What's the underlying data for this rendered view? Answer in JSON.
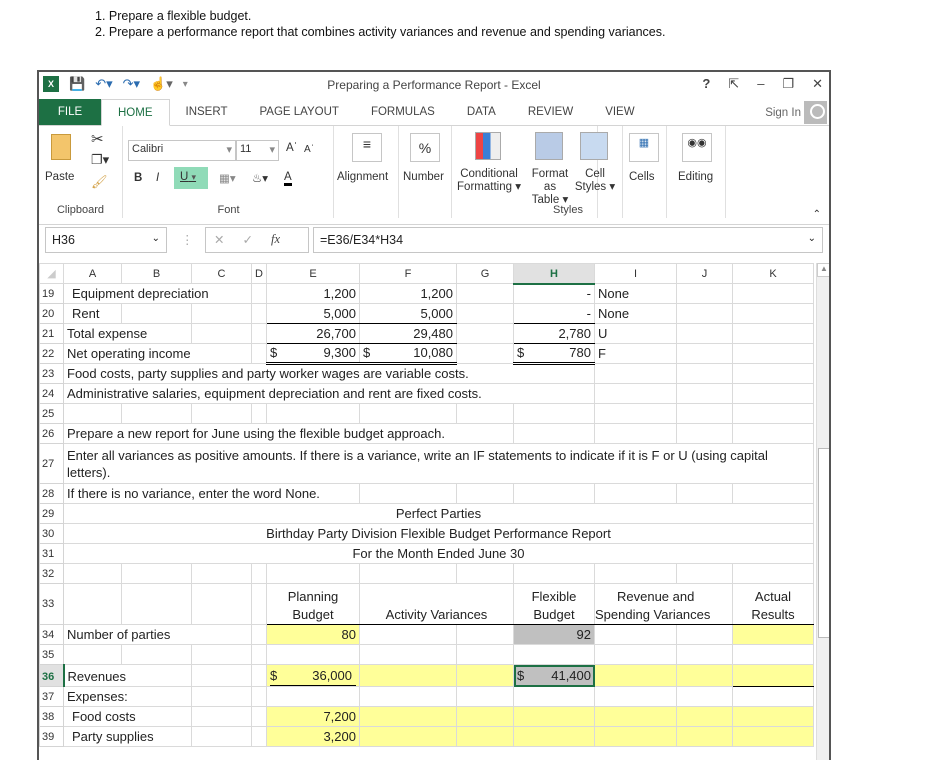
{
  "instructions": [
    "1. Prepare a flexible budget.",
    "2. Prepare a performance report that combines activity variances and revenue and spending variances."
  ],
  "window": {
    "title": "Preparing a Performance Report - Excel",
    "help": "?",
    "sign_in": "Sign In"
  },
  "tabs": [
    "FILE",
    "HOME",
    "INSERT",
    "PAGE LAYOUT",
    "FORMULAS",
    "DATA",
    "REVIEW",
    "VIEW"
  ],
  "ribbon": {
    "paste": "Paste",
    "clipboard": "Clipboard",
    "font_name": "Calibri",
    "font_size": "11",
    "font": "Font",
    "bold": "B",
    "italic": "I",
    "underline": "U",
    "alignment": "Alignment",
    "number": "Number",
    "percent": "%",
    "conditional": "Conditional",
    "formatting": "Formatting",
    "format_as": "Format as",
    "table": "Table",
    "cell": "Cell",
    "styles_btn": "Styles",
    "styles": "Styles",
    "cells": "Cells",
    "editing": "Editing"
  },
  "formula_bar": {
    "name_box": "H36",
    "fx": "fx",
    "formula": "=E36/E34*H34"
  },
  "columns": [
    "A",
    "B",
    "C",
    "D",
    "E",
    "F",
    "G",
    "H",
    "I",
    "J",
    "K"
  ],
  "rows": {
    "r19": {
      "n": "19",
      "a": "Equipment depreciation",
      "e": "1,200",
      "f": "1,200",
      "h": "-",
      "i": "None"
    },
    "r20": {
      "n": "20",
      "a": "Rent",
      "e": "5,000",
      "f": "5,000",
      "h": "-",
      "i": "None"
    },
    "r21": {
      "n": "21",
      "a": "Total expense",
      "e": "26,700",
      "f": "29,480",
      "h": "2,780",
      "i": "U"
    },
    "r22": {
      "n": "22",
      "a": "Net operating income",
      "e_cur": "$",
      "e": "9,300",
      "f_cur": "$",
      "f": "10,080",
      "h_cur": "$",
      "h": "780",
      "i": "F"
    },
    "r23": {
      "n": "23",
      "a": "Food costs, party supplies and party worker wages are variable costs."
    },
    "r24": {
      "n": "24",
      "a": "Administrative salaries, equipment depreciation and rent are fixed costs."
    },
    "r25": {
      "n": "25"
    },
    "r26": {
      "n": "26",
      "a": "Prepare a new report for June using the flexible budget approach."
    },
    "r27": {
      "n": "27",
      "a": "Enter all variances as positive amounts.  If there is a variance, write an IF statements to indicate if it is F or U (using capital letters)."
    },
    "r28": {
      "n": "28",
      "a": "If there is no variance, enter the word None."
    },
    "r29": {
      "n": "29",
      "a": "Perfect Parties"
    },
    "r30": {
      "n": "30",
      "a": "Birthday Party Division Flexible Budget Performance Report"
    },
    "r31": {
      "n": "31",
      "a": "For the Month Ended June 30"
    },
    "r32": {
      "n": "32"
    },
    "r33": {
      "n": "33",
      "e1": "Planning",
      "e2": "Budget",
      "f": "Activity Variances",
      "h1": "Flexible",
      "h2": "Budget",
      "i1": "Revenue and",
      "i2": "Spending Variances",
      "k1": "Actual",
      "k2": "Results"
    },
    "r34": {
      "n": "34",
      "a": "Number of parties",
      "e": "80",
      "h": "92"
    },
    "r35": {
      "n": "35"
    },
    "r36": {
      "n": "36",
      "a": "Revenues",
      "e_cur": "$",
      "e": "36,000",
      "h_cur": "$",
      "h": "41,400"
    },
    "r37": {
      "n": "37",
      "a": "Expenses:"
    },
    "r38": {
      "n": "38",
      "a": "Food costs",
      "e": "7,200"
    },
    "r39": {
      "n": "39",
      "a": "Party supplies",
      "e": "3,200"
    }
  },
  "colors": {
    "excel_green": "#1d7044",
    "input_yellow": "#ffff99",
    "selected_gray": "#c0c0c0"
  }
}
